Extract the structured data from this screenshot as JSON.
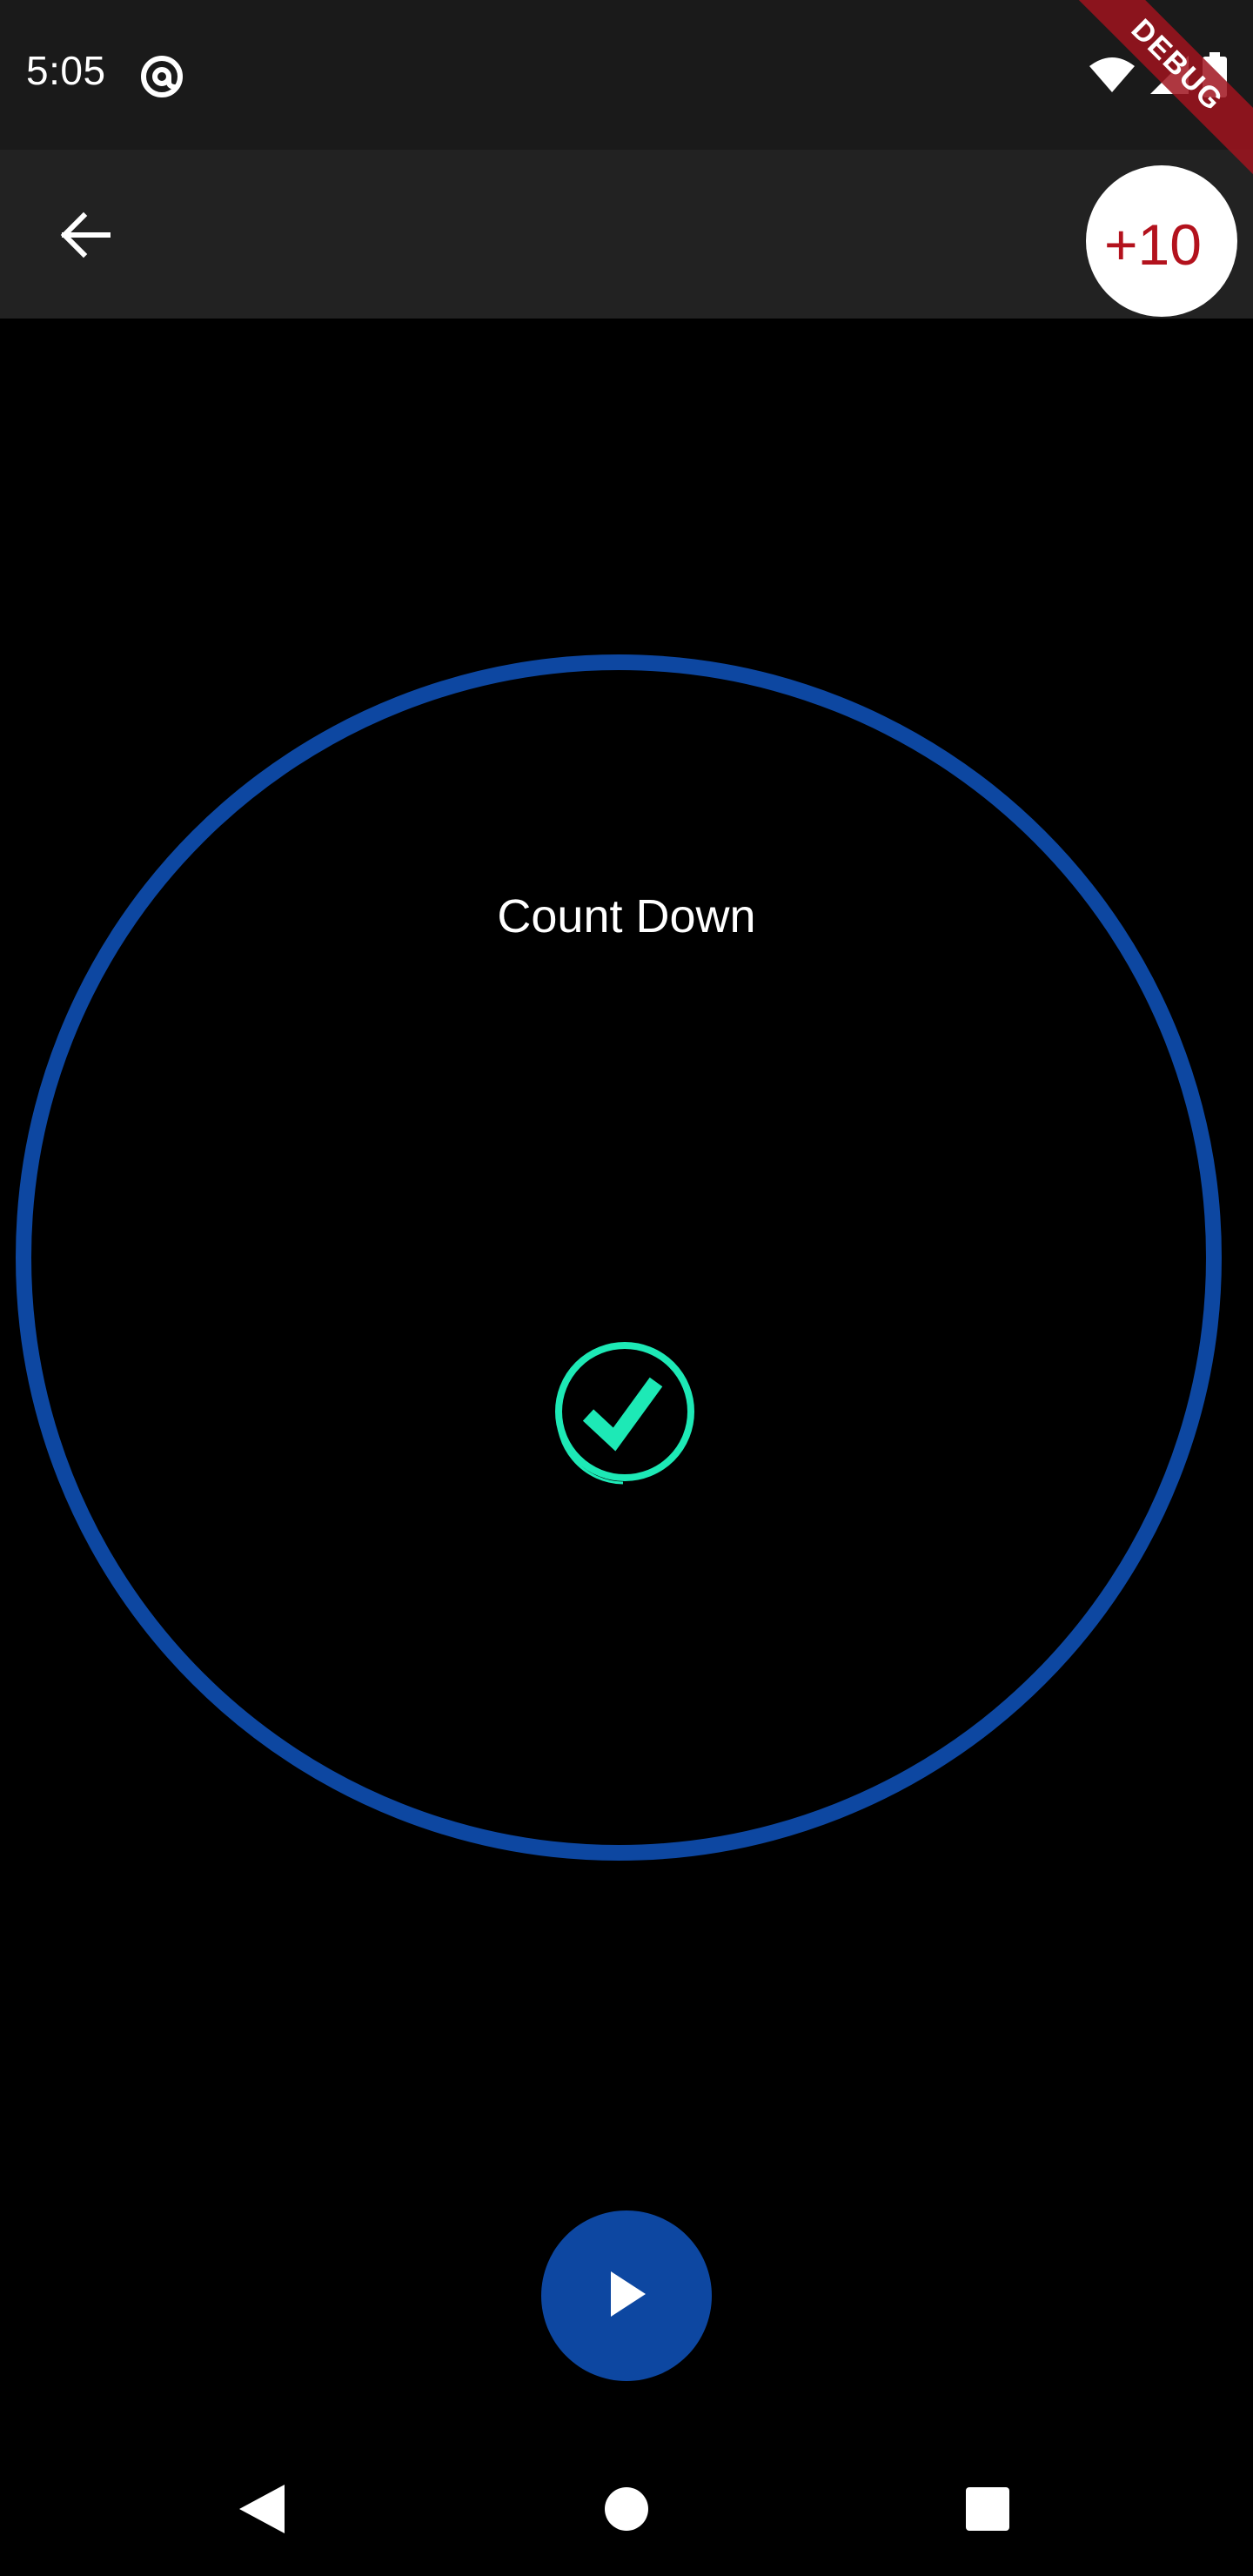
{
  "status_bar": {
    "time": "5:05",
    "left_icon": "at-sign-icon",
    "right_icons": [
      "wifi-icon",
      "cell-signal-icon",
      "battery-icon"
    ]
  },
  "debug_banner": {
    "label": "DEBUG"
  },
  "app_bar": {
    "back_icon": "arrow-left-icon",
    "add_time_label": "+10"
  },
  "timer": {
    "title": "Count Down",
    "state_icon": "check-circle-icon",
    "ring_color": "#0d47a1",
    "check_color": "#1de9b6"
  },
  "controls": {
    "play_icon": "play-icon"
  },
  "nav_bar": {
    "buttons": [
      "back-triangle-icon",
      "home-circle-icon",
      "recents-square-icon"
    ]
  },
  "colors": {
    "background": "#000000",
    "accent": "#0d47a1",
    "add_time_text": "#b3121d",
    "debug_ribbon": "#a0141e"
  }
}
